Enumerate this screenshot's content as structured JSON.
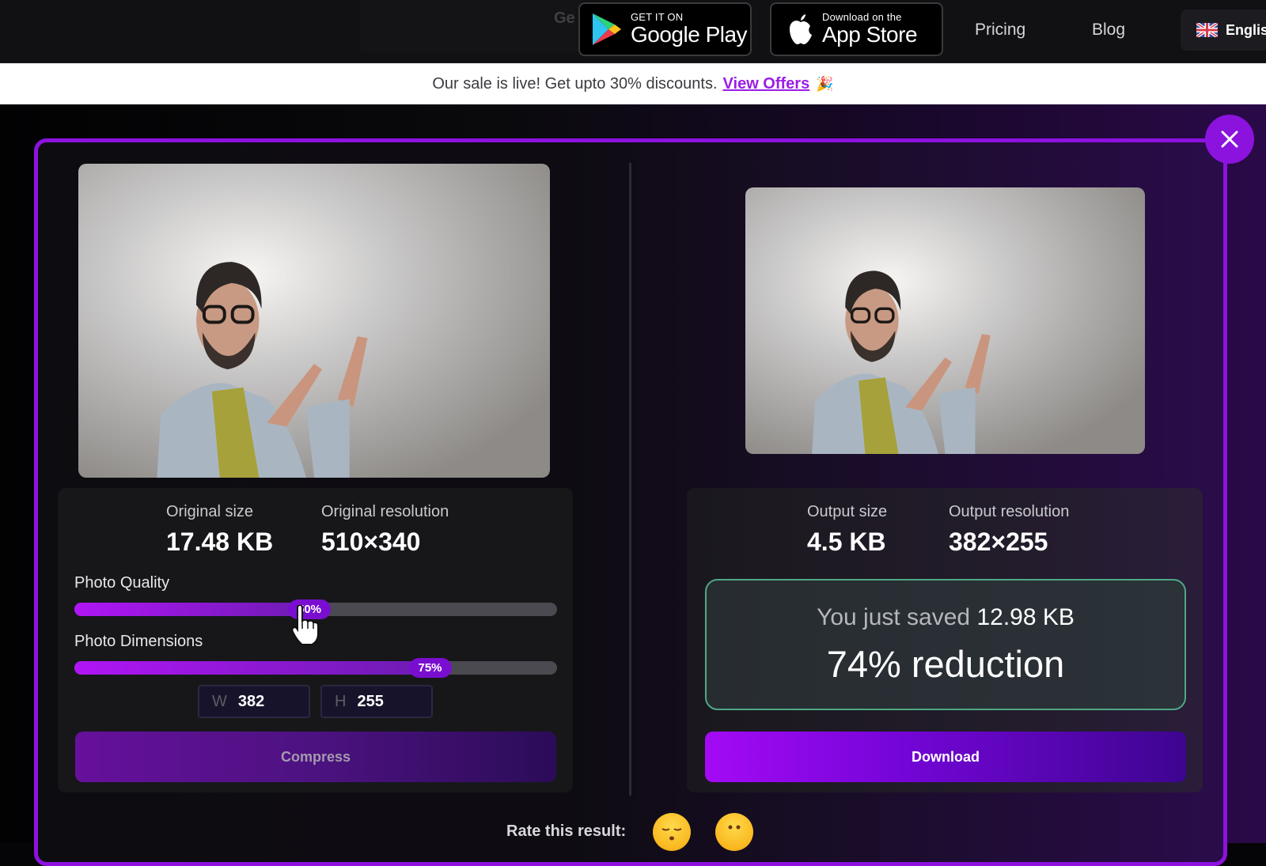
{
  "nav": {
    "ghost_text": "Ge",
    "google_play": {
      "small": "GET IT ON",
      "big": "Google Play"
    },
    "app_store": {
      "small": "Download on the",
      "big": "App Store"
    },
    "links": [
      "Pricing",
      "Blog"
    ],
    "language": "English"
  },
  "banner": {
    "text": "Our sale is live! Get upto 30% discounts.",
    "link_label": "View Offers",
    "emoji": "🎉"
  },
  "original": {
    "size_label": "Original size",
    "size_value": "17.48 KB",
    "resolution_label": "Original resolution",
    "resolution_value": "510×340"
  },
  "controls": {
    "quality_label": "Photo Quality",
    "quality_percent": 50,
    "quality_text": "50%",
    "dimensions_label": "Photo Dimensions",
    "dimensions_percent": 75,
    "dimensions_text": "75%",
    "width_key": "W",
    "width_value": "382",
    "height_key": "H",
    "height_value": "255",
    "compress_label": "Compress"
  },
  "output": {
    "size_label": "Output size",
    "size_value": "4.5 KB",
    "resolution_label": "Output resolution",
    "resolution_value": "382×255",
    "saved_prefix": "You just saved",
    "saved_value": "12.98 KB",
    "reduction_text": "74% reduction",
    "download_label": "Download"
  },
  "rating": {
    "label": "Rate this result:",
    "emojis": [
      "pensive-face",
      "neutral-face"
    ]
  },
  "colors": {
    "accent": "#8c13de",
    "link": "#9b1de6",
    "success_border": "#4fa884"
  }
}
